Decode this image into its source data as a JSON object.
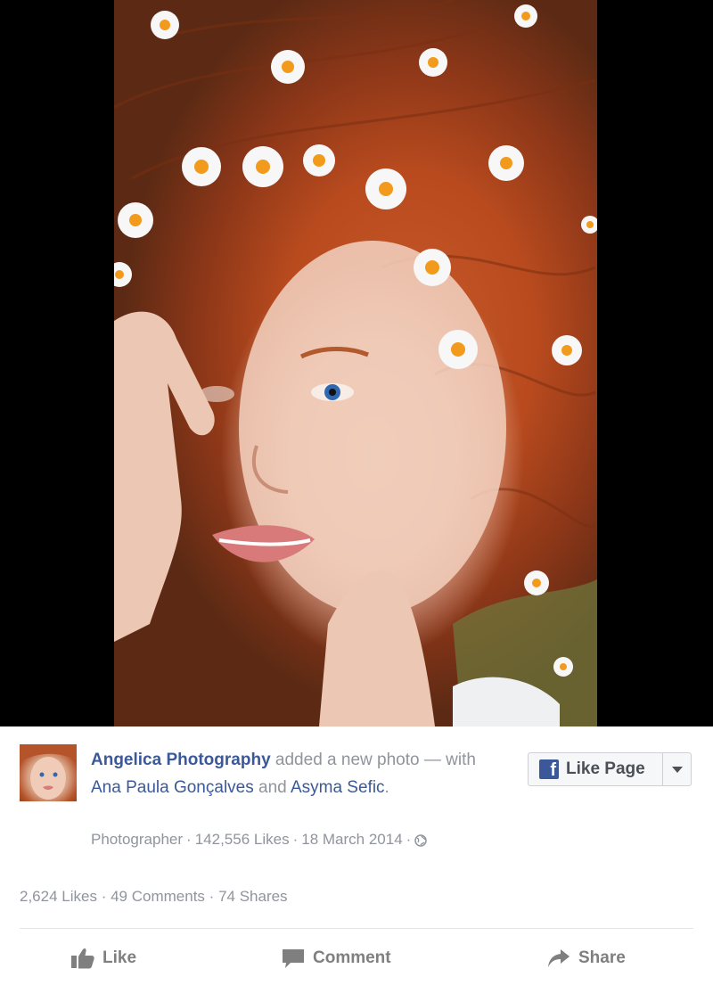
{
  "photo": {
    "alt_subject": "woman with red hair lying among daisies"
  },
  "post": {
    "page_name": "Angelica Photography",
    "action_text": "added a new photo",
    "with_text": "— with",
    "tagged_1": "Ana Paula Gonçalves",
    "and_text": "and",
    "tagged_2": "Asyma Sefic",
    "period": ".",
    "category": "Photographer",
    "page_likes": "142,556 Likes",
    "date": "18 March 2014",
    "separator": "·",
    "privacy_icon": "globe-icon"
  },
  "like_page_button": {
    "label": "Like Page",
    "icon": "facebook-f-icon"
  },
  "stats": {
    "likes": "2,624 Likes",
    "comments": "49 Comments",
    "shares": "74 Shares",
    "separator": "·"
  },
  "actions": {
    "like": "Like",
    "comment": "Comment",
    "share": "Share"
  },
  "colors": {
    "link": "#3b5998",
    "muted": "#90949c",
    "action": "#7f7f7f"
  }
}
